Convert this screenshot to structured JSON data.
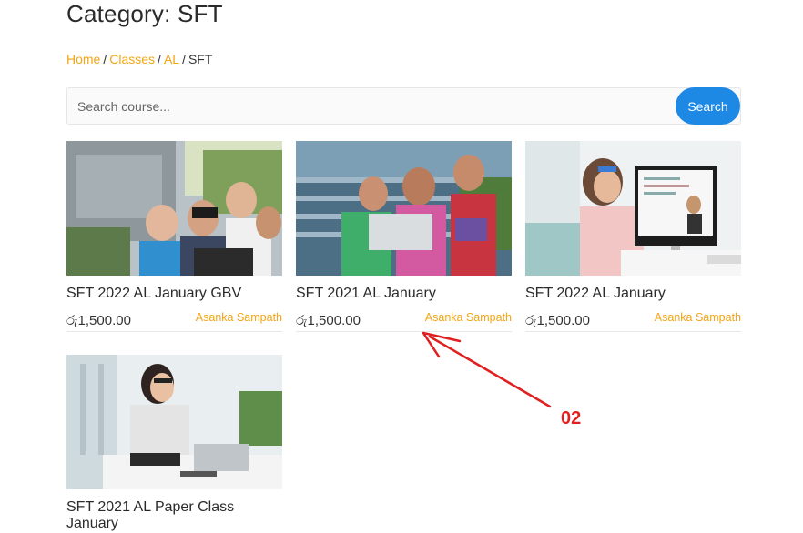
{
  "page": {
    "title": "Category: SFT"
  },
  "breadcrumb": {
    "items": [
      {
        "label": "Home",
        "link": true
      },
      {
        "label": "Classes",
        "link": true
      },
      {
        "label": "AL",
        "link": true
      },
      {
        "label": "SFT",
        "link": false
      }
    ],
    "separator": "/"
  },
  "search": {
    "placeholder": "Search course...",
    "button_label": "Search"
  },
  "courses": [
    {
      "title": "SFT 2022 AL January GBV",
      "price": "රු1,500.00",
      "author": "Asanka Sampath",
      "image_icon": "students-laptop-image"
    },
    {
      "title": "SFT 2021 AL January",
      "price": "රු1,500.00",
      "author": "Asanka Sampath",
      "image_icon": "students-stairs-image"
    },
    {
      "title": "SFT 2022 AL January",
      "price": "රු1,500.00",
      "author": "Asanka Sampath",
      "image_icon": "online-class-image"
    },
    {
      "title": "SFT 2021 AL Paper Class January",
      "price": "",
      "author": "",
      "image_icon": "student-writing-image"
    }
  ],
  "annotation": {
    "label": "02",
    "color": "#e02020"
  },
  "colors": {
    "accent": "#f2a516",
    "button": "#1e88e5"
  }
}
